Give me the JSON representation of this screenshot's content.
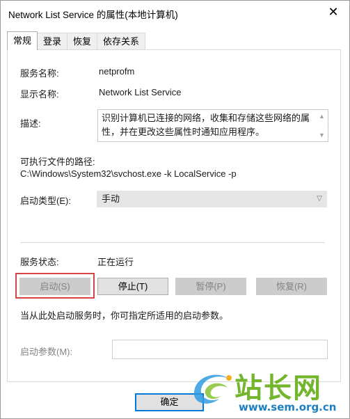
{
  "window": {
    "title": "Network List Service 的属性(本地计算机)",
    "close_glyph": "✕"
  },
  "tabs": [
    {
      "label": "常规",
      "active": true
    },
    {
      "label": "登录",
      "active": false
    },
    {
      "label": "恢复",
      "active": false
    },
    {
      "label": "依存关系",
      "active": false
    }
  ],
  "general": {
    "service_name_label": "服务名称:",
    "service_name_value": "netprofm",
    "display_name_label": "显示名称:",
    "display_name_value": "Network List Service",
    "description_label": "描述:",
    "description_value": "识别计算机已连接的网络，收集和存储这些网络的属性，并在更改这些属性时通知应用程序。",
    "exe_path_label": "可执行文件的路径:",
    "exe_path_value": "C:\\Windows\\System32\\svchost.exe -k LocalService -p",
    "startup_type_label": "启动类型(E):",
    "startup_type_value": "手动",
    "service_status_label": "服务状态:",
    "service_status_value": "正在运行",
    "buttons": {
      "start": "启动(S)",
      "stop": "停止(T)",
      "pause": "暂停(P)",
      "resume": "恢复(R)"
    },
    "hint_text": "当从此处启动服务时，你可指定所适用的启动参数。",
    "start_params_label": "启动参数(M):",
    "start_params_value": ""
  },
  "footer": {
    "ok_label": "确定"
  },
  "watermark": {
    "text": "站长网",
    "url": "www.sem.org.cn"
  },
  "colors": {
    "highlight_border": "#d64545",
    "default_button_border": "#0078d7",
    "watermark_green": "#73b62d",
    "watermark_blue": "#1c7fc2"
  }
}
